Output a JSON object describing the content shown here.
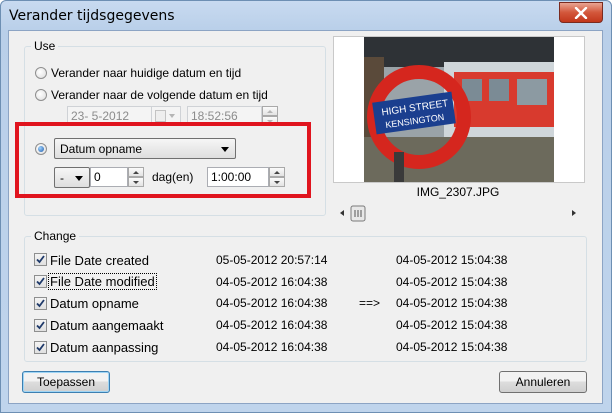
{
  "window": {
    "title": "Verander tijdsgegevens",
    "close_icon": "close-icon"
  },
  "use": {
    "label": "Use",
    "option_now": "Verander naar huidige datum en tijd",
    "option_next": "Verander naar de volgende datum en tijd",
    "next_date": "23-  5-2012",
    "next_time": "18:52:56",
    "selected_option": "property",
    "property_select": "Datum opname",
    "sign_select": "-",
    "days_value": "0",
    "days_unit": "dag(en)",
    "offset_time": "1:00:00"
  },
  "preview": {
    "filename": "IMG_2307.JPG",
    "slider_position": 0.05
  },
  "change": {
    "label": "Change",
    "arrow": "==>",
    "rows": [
      {
        "name": "File Date created",
        "checked": true,
        "old": "05-05-2012 20:57:14",
        "new": "04-05-2012 15:04:38"
      },
      {
        "name": "File Date modified",
        "checked": true,
        "old": "04-05-2012 16:04:38",
        "new": "04-05-2012 15:04:38"
      },
      {
        "name": "Datum opname",
        "checked": true,
        "old": "04-05-2012 16:04:38",
        "new": "04-05-2012 15:04:38"
      },
      {
        "name": "Datum aangemaakt",
        "checked": true,
        "old": "04-05-2012 16:04:38",
        "new": "04-05-2012 15:04:38"
      },
      {
        "name": "Datum aanpassing",
        "checked": true,
        "old": "04-05-2012 16:04:38",
        "new": "04-05-2012 15:04:38"
      }
    ]
  },
  "buttons": {
    "apply": "Toepassen",
    "cancel": "Annuleren"
  },
  "colors": {
    "highlight": "#e0141e",
    "titlebar": "#c8daf0",
    "close": "#c2371c"
  }
}
